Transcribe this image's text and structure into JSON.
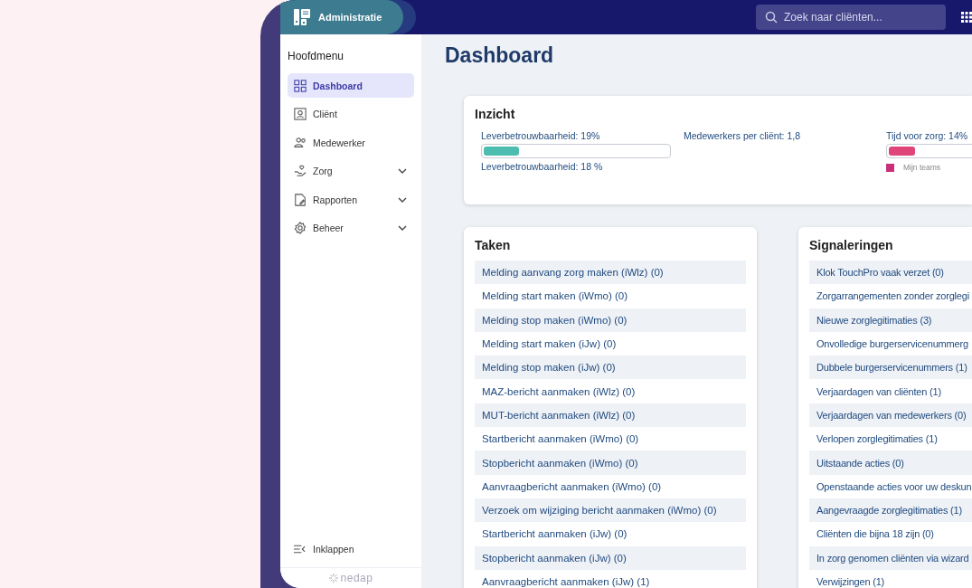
{
  "header": {
    "app_title": "Administratie",
    "search": {
      "placeholder": "Zoek naar cliënten..."
    }
  },
  "sidebar": {
    "heading": "Hoofdmenu",
    "items": [
      {
        "label": "Dashboard",
        "selected": true,
        "expandable": false
      },
      {
        "label": "Cliënt",
        "selected": false,
        "expandable": false
      },
      {
        "label": "Medewerker",
        "selected": false,
        "expandable": false
      },
      {
        "label": "Zorg",
        "selected": false,
        "expandable": true
      },
      {
        "label": "Rapporten",
        "selected": false,
        "expandable": true
      },
      {
        "label": "Beheer",
        "selected": false,
        "expandable": true
      }
    ],
    "collapse": "Inklappen",
    "brand": "nedap"
  },
  "page_title": "Dashboard",
  "insight": {
    "title": "Inzicht",
    "metrics": [
      {
        "kind": "bar",
        "label": "Leverbetrouwbaarheid: 19%",
        "level": 0.19,
        "color": "#4dbdb0",
        "caption": "Leverbetrouwbaarheid: 18 %"
      },
      {
        "kind": "text",
        "label": "Medewerkers per cliënt: 1,8"
      },
      {
        "kind": "bar",
        "label": "Tijd voor zorg: 14%",
        "level": 0.14,
        "color": "#e0457a",
        "legend": {
          "label": "Mijn teams",
          "color": "#c8307a"
        }
      }
    ]
  },
  "tasks": {
    "title": "Taken",
    "items": [
      "Melding aanvang zorg maken (iWlz) (0)",
      "Melding start maken (iWmo) (0)",
      "Melding stop maken (iWmo) (0)",
      "Melding start maken (iJw) (0)",
      "Melding stop maken (iJw) (0)",
      "MAZ-bericht aanmaken (iWlz) (0)",
      "MUT-bericht aanmaken (iWlz) (0)",
      "Startbericht aanmaken (iWmo) (0)",
      "Stopbericht aanmaken (iWmo) (0)",
      "Aanvraagbericht aanmaken (iWmo) (0)",
      "Verzoek om wijziging bericht aanmaken (iWmo) (0)",
      "Startbericht aanmaken (iJw) (0)",
      "Stopbericht aanmaken (iJw) (0)",
      "Aanvraagbericht aanmaken (iJw) (1)"
    ]
  },
  "signals": {
    "title": "Signaleringen",
    "items": [
      "Klok TouchPro vaak verzet (0)",
      "Zorgarrangementen zonder zorglegi",
      "Nieuwe zorglegitimaties (3)",
      "Onvolledige burgerservicenummerg",
      "Dubbele burgerservicenummers (1)",
      "Verjaardagen van cliënten (1)",
      "Verjaardagen van medewerkers (0)",
      "Verlopen zorglegitimaties (1)",
      "Uitstaande acties (0)",
      "Openstaande acties voor uw deskun",
      "Aangevraagde zorglegitimaties (1)",
      "Cliënten die bijna 18 zijn (0)",
      "In zorg genomen cliënten via wizard",
      "Verwijzingen (1)"
    ]
  }
}
